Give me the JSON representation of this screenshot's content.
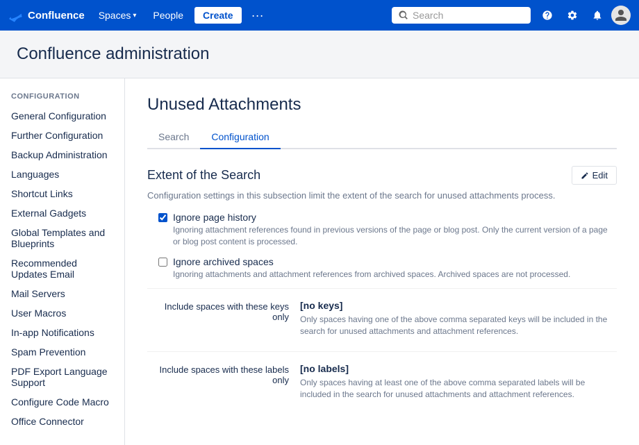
{
  "topnav": {
    "logo_text": "Confluence",
    "spaces_label": "Spaces",
    "people_label": "People",
    "create_label": "Create",
    "search_placeholder": "Search",
    "more_icon": "···"
  },
  "page_header": {
    "title": "Confluence administration"
  },
  "sidebar": {
    "section_label": "CONFIGURATION",
    "items": [
      {
        "label": "General Configuration",
        "active": false
      },
      {
        "label": "Further Configuration",
        "active": false
      },
      {
        "label": "Backup Administration",
        "active": false
      },
      {
        "label": "Languages",
        "active": false
      },
      {
        "label": "Shortcut Links",
        "active": false
      },
      {
        "label": "External Gadgets",
        "active": false
      },
      {
        "label": "Global Templates and Blueprints",
        "active": false
      },
      {
        "label": "Recommended Updates Email",
        "active": false
      },
      {
        "label": "Mail Servers",
        "active": false
      },
      {
        "label": "User Macros",
        "active": false
      },
      {
        "label": "In-app Notifications",
        "active": false
      },
      {
        "label": "Spam Prevention",
        "active": false
      },
      {
        "label": "PDF Export Language Support",
        "active": false
      },
      {
        "label": "Configure Code Macro",
        "active": false
      },
      {
        "label": "Office Connector",
        "active": false
      }
    ]
  },
  "content": {
    "title": "Unused Attachments",
    "tabs": [
      {
        "label": "Search",
        "active": false
      },
      {
        "label": "Configuration",
        "active": true
      }
    ],
    "section": {
      "title": "Extent of the Search",
      "edit_label": "Edit",
      "description": "Configuration settings in this subsection limit the extent of the search for unused attachments process.",
      "checkboxes": [
        {
          "label": "Ignore page history",
          "checked": true,
          "description": "Ignoring attachment references found in previous versions of the page or blog post. Only the current version of a page or blog post content is processed."
        },
        {
          "label": "Ignore archived spaces",
          "checked": false,
          "description": "Ignoring attachments and attachment references from archived spaces. Archived spaces are not processed."
        }
      ],
      "config_rows": [
        {
          "label": "Include spaces with these keys only",
          "value": "[no keys]",
          "description": "Only spaces having one of the above comma separated keys will be included in the search for unused attachments and attachment references."
        },
        {
          "label": "Include spaces with these labels only",
          "value": "[no labels]",
          "description": "Only spaces having at least one of the above comma separated labels will be included in the search for unused attachments and attachment references."
        }
      ]
    }
  }
}
